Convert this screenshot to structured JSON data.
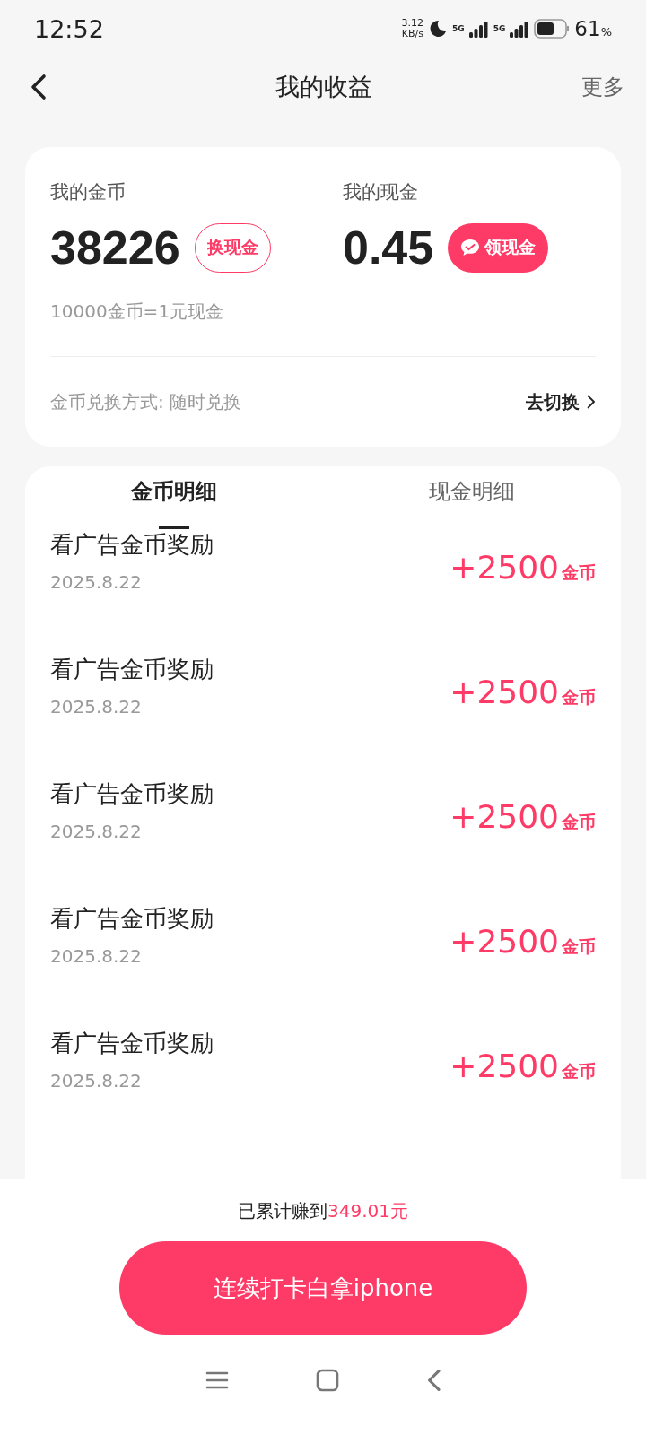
{
  "status_bar": {
    "time": "12:52",
    "net_speed": "3.12",
    "net_unit": "KB/s",
    "sim": [
      "5G",
      "5G"
    ],
    "battery_percent": "61",
    "battery_unit": "%"
  },
  "nav": {
    "title": "我的收益",
    "more": "更多"
  },
  "balance": {
    "coins": {
      "label": "我的金币",
      "value": "38226",
      "action": "换现金"
    },
    "cash": {
      "label": "我的现金",
      "value": "0.45",
      "action": "领现金"
    },
    "rate": "10000金币=1元现金",
    "method": "金币兑换方式: 随时兑换",
    "switch": "去切换"
  },
  "tabs": [
    {
      "label": "金币明细",
      "selected": true
    },
    {
      "label": "现金明细",
      "selected": false
    }
  ],
  "records": [
    {
      "title": "看广告金币奖励",
      "date": "2025.8.22",
      "amount": "+2500",
      "unit": "金币"
    },
    {
      "title": "看广告金币奖励",
      "date": "2025.8.22",
      "amount": "+2500",
      "unit": "金币"
    },
    {
      "title": "看广告金币奖励",
      "date": "2025.8.22",
      "amount": "+2500",
      "unit": "金币"
    },
    {
      "title": "看广告金币奖励",
      "date": "2025.8.22",
      "amount": "+2500",
      "unit": "金币"
    },
    {
      "title": "看广告金币奖励",
      "date": "2025.8.22",
      "amount": "+2500",
      "unit": "金币"
    }
  ],
  "footer": {
    "earned_label": "已累计赚到",
    "earned_amount": "349.01元",
    "button": "连续打卡白拿iphone"
  }
}
